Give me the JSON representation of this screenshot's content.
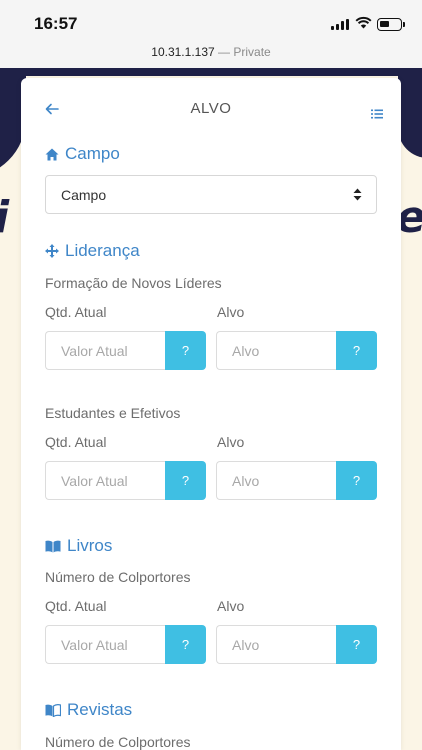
{
  "status": {
    "time": "16:57"
  },
  "browser": {
    "url": "10.31.1.137",
    "separator": " — ",
    "mode": "Private"
  },
  "header": {
    "title": "ALVO"
  },
  "campo": {
    "heading": "Campo",
    "select_value": "Campo"
  },
  "lideranca": {
    "heading": "Liderança",
    "groups": [
      {
        "title": "Formação de Novos Líderes",
        "current_label": "Qtd. Atual",
        "target_label": "Alvo",
        "current_placeholder": "Valor Atual",
        "target_placeholder": "Alvo",
        "help": "?"
      },
      {
        "title": "Estudantes e Efetivos",
        "current_label": "Qtd. Atual",
        "target_label": "Alvo",
        "current_placeholder": "Valor Atual",
        "target_placeholder": "Alvo",
        "help": "?"
      }
    ]
  },
  "livros": {
    "heading": "Livros",
    "groups": [
      {
        "title": "Número de Colportores",
        "current_label": "Qtd. Atual",
        "target_label": "Alvo",
        "current_placeholder": "Valor Atual",
        "target_placeholder": "Alvo",
        "help": "?"
      }
    ]
  },
  "revistas": {
    "heading": "Revistas",
    "groups": [
      {
        "title": "Número de Colportores"
      }
    ]
  },
  "colors": {
    "accent": "#3f86c8",
    "help_button": "#3fbfe3",
    "background": "#fbf5e6",
    "decoration": "#1f2147"
  },
  "icons": {
    "back": "arrow-left-icon",
    "menu": "list-icon",
    "campo": "home-icon",
    "lideranca": "move-arrows-icon",
    "livros": "open-book-icon",
    "revistas": "book-icon",
    "select": "sort-arrows-icon"
  }
}
